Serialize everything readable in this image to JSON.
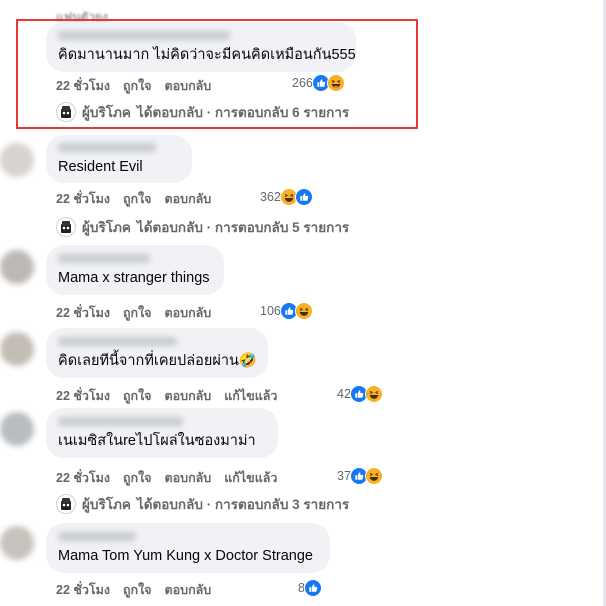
{
  "top_partial": "แฟนตัวยง",
  "action_labels": {
    "like": "ถูกใจ",
    "reply": "ตอบกลับ",
    "edited": "แก้ไขแล้ว"
  },
  "reply_prefix": "ผู้บริโภค",
  "comments": [
    {
      "text": "คิดมานานมาก ไม่คิดว่าจะมีคนคิดเหมือนกัน555",
      "time": "22 ชั่วโมง",
      "count": "266",
      "reacts": [
        "like",
        "haha"
      ],
      "replies": "ได้ตอบกลับ · การตอบกลับ 6 รายการ"
    },
    {
      "text": "Resident Evil",
      "time": "22 ชั่วโมง",
      "count": "362",
      "reacts": [
        "haha",
        "like"
      ],
      "replies": "ได้ตอบกลับ · การตอบกลับ 5 รายการ"
    },
    {
      "text": "Mama x stranger things",
      "time": "22 ชั่วโมง",
      "count": "106",
      "reacts": [
        "like",
        "haha"
      ]
    },
    {
      "text": "คิดเลยทีนี้จากที่เคยปล่อยผ่าน🤣",
      "time": "22 ชั่วโมง",
      "count": "42",
      "edited": true,
      "reacts": [
        "like",
        "haha"
      ]
    },
    {
      "text": "เนเมซิสในreไปโผล่ในซองมาม่า",
      "time": "22 ชั่วโมง",
      "count": "37",
      "edited": true,
      "reacts": [
        "like",
        "haha"
      ],
      "replies": "ได้ตอบกลับ · การตอบกลับ 3 รายการ"
    },
    {
      "text": "Mama Tom Yum Kung x Doctor Strange",
      "time": "22 ชั่วโมง",
      "count": "8",
      "reacts": [
        "like"
      ]
    }
  ],
  "colors": {
    "bubble": "#f0f2f5",
    "muted": "#65676b",
    "like": "#1877f2",
    "haha": "#f7b125",
    "highlight": "#e53935"
  }
}
